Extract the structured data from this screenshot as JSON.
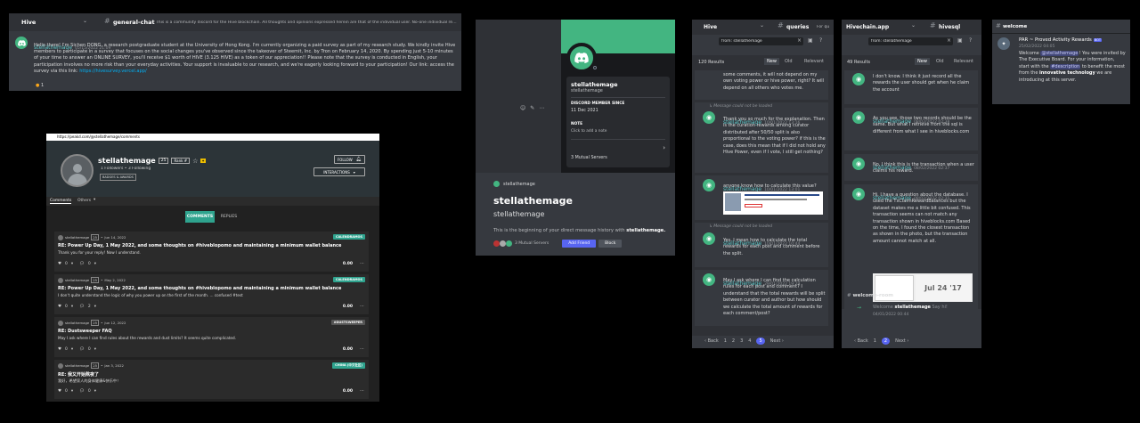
{
  "panelA": {
    "server": "Hive",
    "channel": "general-chat",
    "topic": "This is a community discord for the Hive blockchain. All thoughts and opinions expressed herein are that of the individual user. No-one individual represents",
    "message": {
      "user": "stellathemage",
      "timestamp": "05/15/2022 21:09",
      "text": "Hello there! I'm Sichen DONG, a research postgraduate student at the University of Hong Kong. I'm currently organizing a paid survey as part of my research study. We kindly invite Hive members to participate in a survey that focuses on the social changes you've observed since the takeover of Steemit, Inc. by Tron on February 14, 2020. By spending just 5-10 minutes of your time to answer an ONLINE SURVEY, you'll receive $1 worth of HIVE (3.125 HIVE) as a token of our appreciation!! Please note that the survey is conducted in English, your participation involves no more risk than your everyday activities. Your support is invaluable to our research, and we're eagerly looking forward to your participation! Our link: access the survey via this link: ",
      "link": "https://hivesurvey.vercel.app/",
      "reaction": "1"
    }
  },
  "panelB": {
    "url": "https://peakd.com/@stellathemage/comments",
    "username": "stellathemage",
    "rep": "25",
    "badge": "Rank #",
    "followers": "1 Followers • 3 Following",
    "badges_btn": "BADGES & AWARDS",
    "follow_btn": "FOLLOW",
    "interactions_btn": "INTERACTIONS",
    "tabs": [
      "Comments",
      "Others"
    ],
    "subtabs": [
      "COMMENTS",
      "REPLIES"
    ],
    "posts": [
      {
        "user": "stellathemage",
        "rep": "25",
        "date": "Jun 14, 2022",
        "tag": "CALENDRAMOS",
        "title": "RE: Power Up Day, 1 May 2022, and some thoughts on #hiveblopomo and maintaining a minimum wallet balance",
        "body": "Thank you for your reply! Now I understand.",
        "votes": "0",
        "comments": "0",
        "payout": "0.00"
      },
      {
        "user": "stellathemage",
        "rep": "25",
        "date": "May 2, 2022",
        "tag": "CALENDRAMOS",
        "title": "RE: Power Up Day, 1 May 2022, and some thoughts on #hiveblopomo and maintaining a minimum wallet balance",
        "body": "I don't quite understand the logic of why you power up on the first of the month. ... confused #test",
        "votes": "0",
        "comments": "2",
        "payout": "0.00"
      },
      {
        "user": "stellathemage",
        "rep": "25",
        "date": "Jun 12, 2022",
        "tag": "#DUSTSWEEPER",
        "title": "RE: Dustsweeper FAQ",
        "body": "May I ask where I can find rules about the rewards and dust limits? It seems quite complicated.",
        "votes": "0",
        "comments": "0",
        "payout": "0.00"
      },
      {
        "user": "stellathemage",
        "rep": "25",
        "date": "Jan 3, 2022",
        "tag": "CHINA (中文社区)",
        "title": "RE: 我又开始熬夜了",
        "body": "我好，希望家人的身体健康&快乐中！",
        "votes": "0",
        "comments": "0",
        "payout": "0.00"
      }
    ]
  },
  "panelC": {
    "username": "stellathemage",
    "tag": "stellathemage",
    "member_label": "DISCORD MEMBER SINCE",
    "member_since": "11 Dec 2021",
    "note_label": "NOTE",
    "note_placeholder": "Click to add a note",
    "mutual": "3 Mutual Servers",
    "dm_user": "stellathemage",
    "big_name": "stellathemage",
    "big_sub": "stellathemage",
    "dm_intro": "This is the beginning of your direct message history with ",
    "dm_intro_user": "stellathemage.",
    "mutual_small": "3 Mutual Servers",
    "add_friend": "Add Friend",
    "block": "Block"
  },
  "panelD": {
    "server": "Hive",
    "channel": "queries",
    "channel_more": "For qu",
    "search": "from: stellathemage",
    "results": "120 Results",
    "sort": [
      "New",
      "Old",
      "Relevant"
    ],
    "top_text": "some comments, it will not depend on my own voting power or hive power, right? It will depend on all others who votes me.",
    "msgs": [
      {
        "notice": "Message could not be loaded",
        "user": "stellathemage",
        "time": "10/01/2022 13:16",
        "text": "Thank you so much for the explanation. Then is the curation rewards among curator distributed after 50/50 split is also proportional to the voting power? if this is the case, does this mean that if I did not hold any Hive Power, even if I vote, I still get nothing?"
      },
      {
        "notice": "",
        "user": "stellathemage",
        "time": "10/01/2022 13:01",
        "text": "anyone know how to calculate this value?"
      },
      {
        "notice": "Message could not be loaded",
        "user": "stellathemage",
        "time": "10/01/2022 10:44",
        "text": "Yes. I mean how to calculate the total rewards for each post and comment before the split."
      },
      {
        "notice": "",
        "user": "stellathemage",
        "time": "29/01/2022 19:29",
        "text": "May I ask where I can find the calculation rules for each post and comment? I understand that the total rewards will be split between curator and author but how should we calculate the total amount of rewards for each comment/post?"
      }
    ],
    "pager": [
      "Back",
      "1",
      "2",
      "3",
      "4",
      "5",
      "Next"
    ]
  },
  "panelE": {
    "server": "Hivechain.app",
    "channel": "hivesql",
    "search": "from: stellathemage",
    "results": "49 Results",
    "sort": [
      "New",
      "Old",
      "Relevant"
    ],
    "msgs": [
      {
        "user": "",
        "time": "",
        "text": "I don't know. I think it just record all the rewards the user should get when he claim the account"
      },
      {
        "user": "stellathemage",
        "time": "08/02/2022 02:38",
        "text": "As you see, those two records should be the same. But what I retrieve from the sql is different from what I see in hiveblocks.com"
      },
      {
        "user": "stellathemage",
        "time": "08/02/2022 02:37",
        "text": "No, I think this is the transaction when a user claims his reward."
      },
      {
        "user": "stellathemage",
        "time": "08/02/2022 02:31",
        "text": "Hi, I have a question about the database. I used the TxClaimRewardBalances but the dataset makes me a little bit confused. This transaction seems can not match any transaction shown in hiveblocks.com Based on the time, I found the closest transaction as shown in the photo, but the transaction amount cannot match at all."
      }
    ],
    "img_text": "Jul 24 '17",
    "welcome_channel": "welcome-room",
    "welcome_text": "Welcome ",
    "welcome_user": "stellathemage",
    "welcome_say": "Say hi!",
    "welcome_time": "04/01/2022 00:44",
    "pager": [
      "Back",
      "1",
      "2",
      "Next"
    ]
  },
  "panelF": {
    "channel": "welcome",
    "bot": "PAR ~ Proved Activity Rewards",
    "bot_tag": "BOT",
    "time": "25/02/2022 04:05",
    "t1": "Welcome ",
    "mention": "@stellathemage",
    "t2": "! You were invited by The Executive Board. For your information, start with the ",
    "channel_mention": "#description",
    "t3": " to benefit the most from the ",
    "bold": "innovative technology",
    "t4": " we are introducing at this server."
  },
  "colors": {
    "discord_bg": "#36393f",
    "blurple": "#5865f2",
    "peakd_teal": "#2fa38e",
    "green_banner": "#43b581"
  }
}
